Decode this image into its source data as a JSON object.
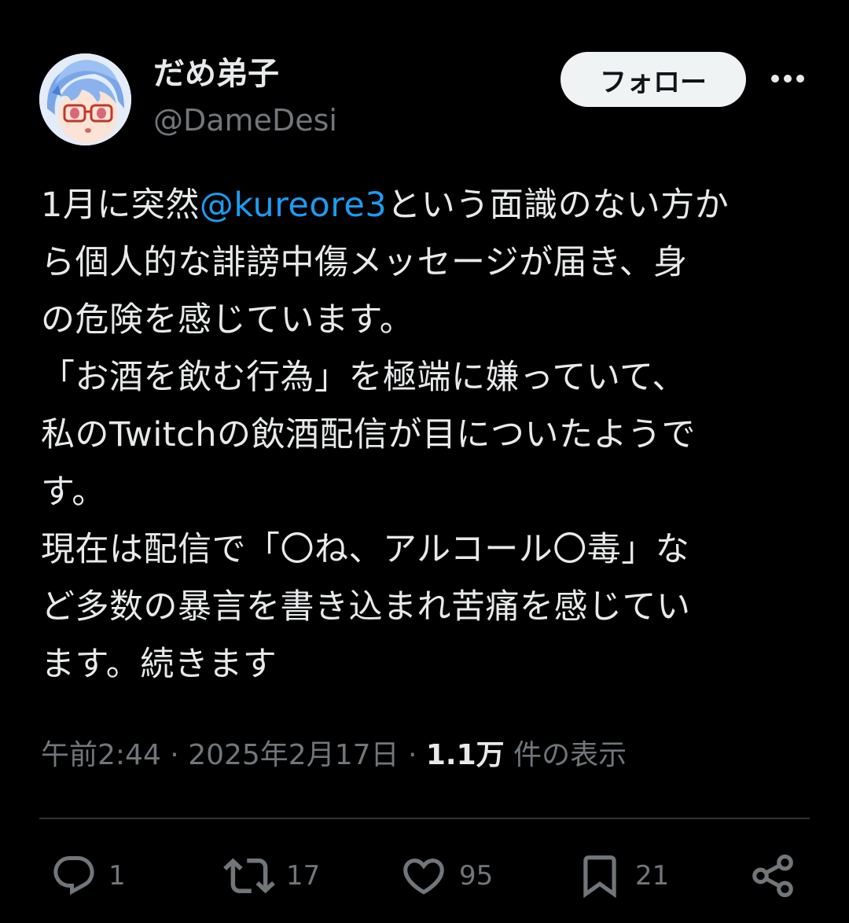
{
  "user": {
    "display_name": "だめ弟子",
    "handle": "@DameDesi"
  },
  "header": {
    "follow_label": "フォロー",
    "more_icon": "more-horizontal-icon"
  },
  "tweet": {
    "lines": [
      {
        "before": "1月に突然",
        "mention": "@kureore3",
        "after": "という面識のない方か"
      },
      {
        "text": "ら個人的な誹謗中傷メッセージが届き、身"
      },
      {
        "text": "の危険を感じています。"
      },
      {
        "text": "「お酒を飲む行為」を極端に嫌っていて、"
      },
      {
        "text": "私のTwitchの飲酒配信が目についたようで"
      },
      {
        "text": "す。"
      },
      {
        "text": "現在は配信で「〇ね、アルコール〇毒」な"
      },
      {
        "text": "ど多数の暴言を書き込まれ苦痛を感じてい"
      },
      {
        "text": "ます。続きます"
      }
    ]
  },
  "meta": {
    "time": "午前2:44",
    "date": "2025年2月17日",
    "separator": " · ",
    "views_count": "1.1万",
    "views_label": " 件の表示"
  },
  "actions": {
    "reply": {
      "icon": "reply-icon",
      "count": "1"
    },
    "repost": {
      "icon": "repost-icon",
      "count": "17"
    },
    "like": {
      "icon": "heart-icon",
      "count": "95"
    },
    "bookmark": {
      "icon": "bookmark-icon",
      "count": "21"
    },
    "share": {
      "icon": "share-icon"
    }
  },
  "colors": {
    "background": "#000000",
    "text": "#e7e9ea",
    "secondary": "#71767b",
    "link": "#1d9bf0",
    "follow_bg": "#eff3f4",
    "divider": "#2f3336"
  }
}
